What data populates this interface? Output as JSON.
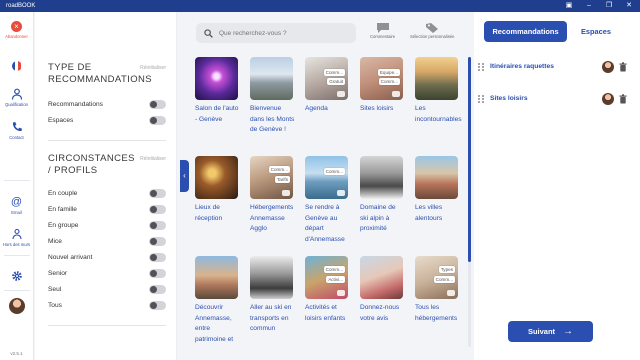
{
  "window": {
    "title": "roadBOOK"
  },
  "nav": {
    "close_label": "Abandonner",
    "qualification_label": "Qualification",
    "contact_label": "Contact",
    "email_label": "Email",
    "others_label": "Hors des murs",
    "version": "v2.5.1"
  },
  "filters": {
    "type": {
      "title": "TYPE DE RECOMMANDATIONS",
      "reset_label": "Réinitialiser",
      "options": [
        "Recommandations",
        "Espaces"
      ]
    },
    "circumstances": {
      "title": "CIRCONSTANCES / PROFILS",
      "reset_label": "Réinitialiser",
      "options": [
        "En couple",
        "En famille",
        "En groupe",
        "Mice",
        "Nouvel arrivant",
        "Senior",
        "Seul",
        "Tous"
      ]
    }
  },
  "search": {
    "placeholder": "Que recherchez-vous ?"
  },
  "tools": {
    "comment_label": "Commentaire",
    "custom_label": "Sélection personnalisée"
  },
  "cards": [
    {
      "title": "Salon de l'auto - Genève",
      "tags": []
    },
    {
      "title": "Bienvenue dans les Monts de Genève !",
      "tags": []
    },
    {
      "title": "Agenda",
      "tags": [
        "Comm...",
        "Gratuit"
      ]
    },
    {
      "title": "Sites loisirs",
      "tags": [
        "Equipe...",
        "Comm..."
      ]
    },
    {
      "title": "Les incontournables",
      "tags": []
    },
    {
      "title": "Lieux de réception",
      "tags": []
    },
    {
      "title": "Hébergements Annemasse Agglo",
      "tags": [
        "Comm...",
        "Tarifs"
      ]
    },
    {
      "title": "Se rendre à Genève au départ d'Annemasse",
      "tags": [
        "Comm..."
      ]
    },
    {
      "title": "Domaine de ski alpin à proximité",
      "tags": []
    },
    {
      "title": "Les villes alentours",
      "tags": []
    },
    {
      "title": "Découvrir Annemasse, entre patrimoine et",
      "tags": []
    },
    {
      "title": "Aller au ski en transports en commun",
      "tags": []
    },
    {
      "title": "Activités et loisirs enfants",
      "tags": [
        "Comm...",
        "Activi..."
      ]
    },
    {
      "title": "Donnez-nous votre avis",
      "tags": []
    },
    {
      "title": "Tous les hébergements",
      "tags": [
        "Types",
        "Comm..."
      ]
    }
  ],
  "right": {
    "tab_recommendations": "Recommandations",
    "tab_spaces": "Espaces",
    "selected": [
      {
        "label": "Itinéraires raquettes"
      },
      {
        "label": "Sites loisirs"
      }
    ],
    "next_label": "Suivant"
  },
  "colors": {
    "primary": "#2a4fb0",
    "title_bar": "#1f3f8e",
    "close": "#e94b3c"
  }
}
